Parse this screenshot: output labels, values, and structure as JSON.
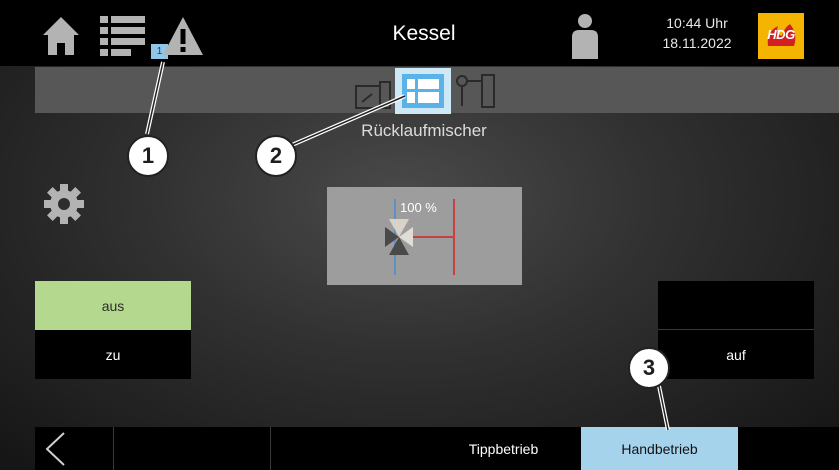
{
  "header": {
    "title": "Kessel",
    "time": "10:44 Uhr",
    "date": "18.11.2022",
    "logo_text": "HDG",
    "alarm_count": "1",
    "icons": [
      "home-icon",
      "list-icon",
      "warning-icon",
      "user-icon"
    ]
  },
  "subnav": {
    "label": "Rücklaufmischer",
    "icons": [
      "boiler-icon",
      "mixer-icon",
      "pump-icon"
    ]
  },
  "main": {
    "settings_icon": "gear-icon",
    "mixer_percent": "100 %",
    "buttons": {
      "aus": "aus",
      "zu": "zu",
      "blank": "",
      "auf": "auf"
    }
  },
  "footer": {
    "back_icon": "chevron-left-icon",
    "tabs": [
      {
        "label": "Tippbetrieb",
        "active": false
      },
      {
        "label": "Handbetrieb",
        "active": true
      }
    ]
  },
  "callouts": [
    "1",
    "2",
    "3"
  ],
  "colors": {
    "active_green": "#b5d88f",
    "active_blue": "#a6d3ec",
    "logo": "#f4b400",
    "badge": "#8fc6ea"
  }
}
